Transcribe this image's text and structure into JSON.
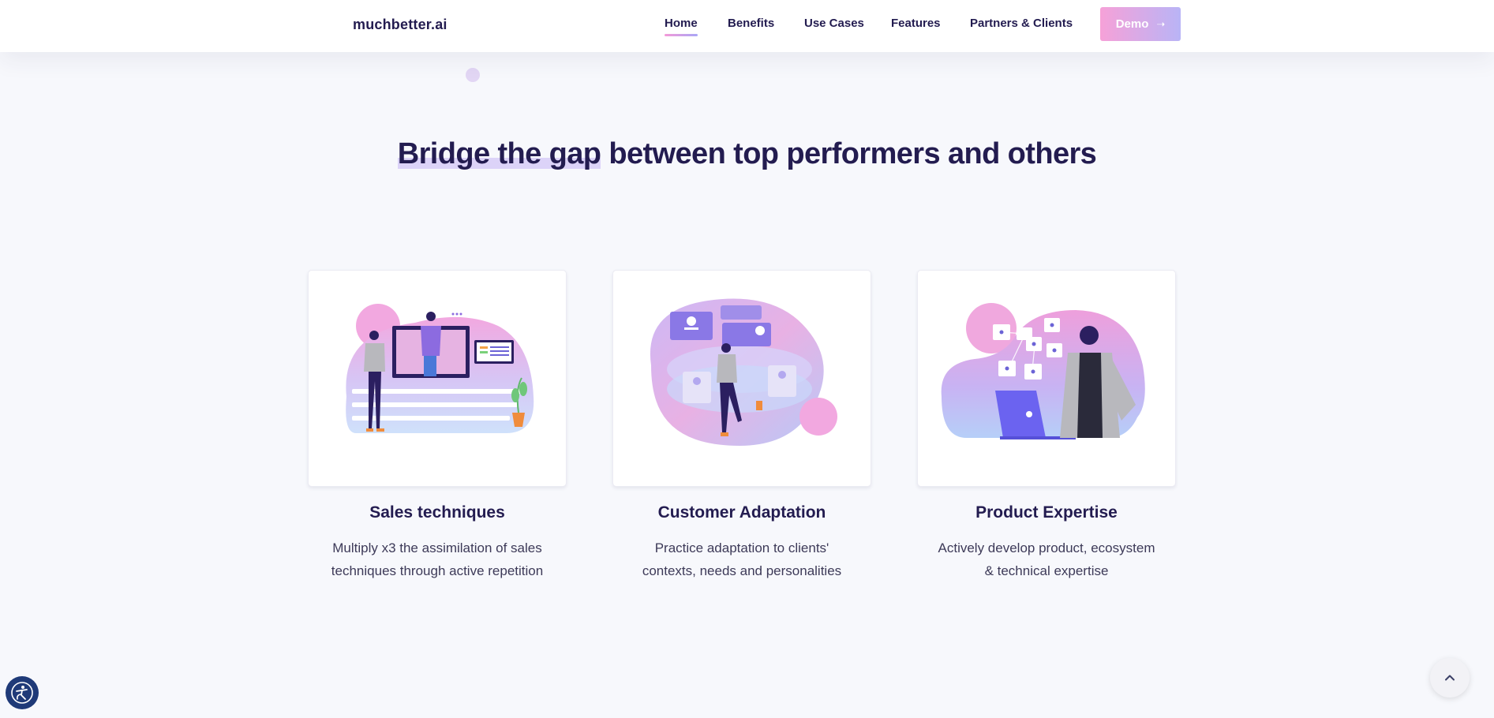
{
  "brand": {
    "name": "muchbetter.ai",
    "logo_icon": "soundwave-icon"
  },
  "nav": {
    "items": [
      {
        "label": "Home",
        "active": true
      },
      {
        "label": "Benefits",
        "active": false
      },
      {
        "label": "Use Cases",
        "active": false
      },
      {
        "label": "Features",
        "active": false
      },
      {
        "label": "Partners & Clients",
        "active": false
      }
    ],
    "demo_label": "Demo",
    "demo_icon": "arrow-right-icon"
  },
  "hero": {
    "headline_highlight": "Bridge the gap",
    "headline_rest": " between top performers and others"
  },
  "cards": [
    {
      "title": "Sales techniques",
      "desc_line1": "Multiply x3 the assimilation of sales",
      "desc_line2": "techniques through active repetition",
      "illustration": "presentation-illustration"
    },
    {
      "title": "Customer Adaptation",
      "desc_line1": "Practice adaptation to clients'",
      "desc_line2": "contexts, needs and personalities",
      "illustration": "customer-profiles-illustration"
    },
    {
      "title": "Product Expertise",
      "desc_line1": "Actively develop product, ecosystem",
      "desc_line2": "& technical expertise",
      "illustration": "laptop-expert-illustration"
    }
  ],
  "widgets": {
    "accessibility_icon": "accessibility-icon",
    "scroll_top_icon": "chevron-up-icon"
  },
  "colors": {
    "text_dark": "#231c50",
    "accent_pink": "#f49ad8",
    "accent_violet": "#a9a6f6",
    "page_bg": "#f7f8fc"
  }
}
